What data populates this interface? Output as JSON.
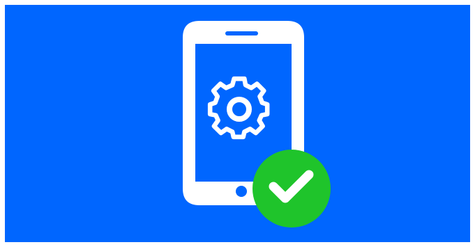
{
  "colors": {
    "frame": "#ffffff",
    "background": "#0066ff",
    "outline": "#ffffff",
    "badge": "#1fc42b",
    "check": "#ffffff"
  },
  "icons": {
    "device": "smartphone-icon",
    "settings": "gear-icon",
    "status": "checkmark-badge-icon"
  }
}
